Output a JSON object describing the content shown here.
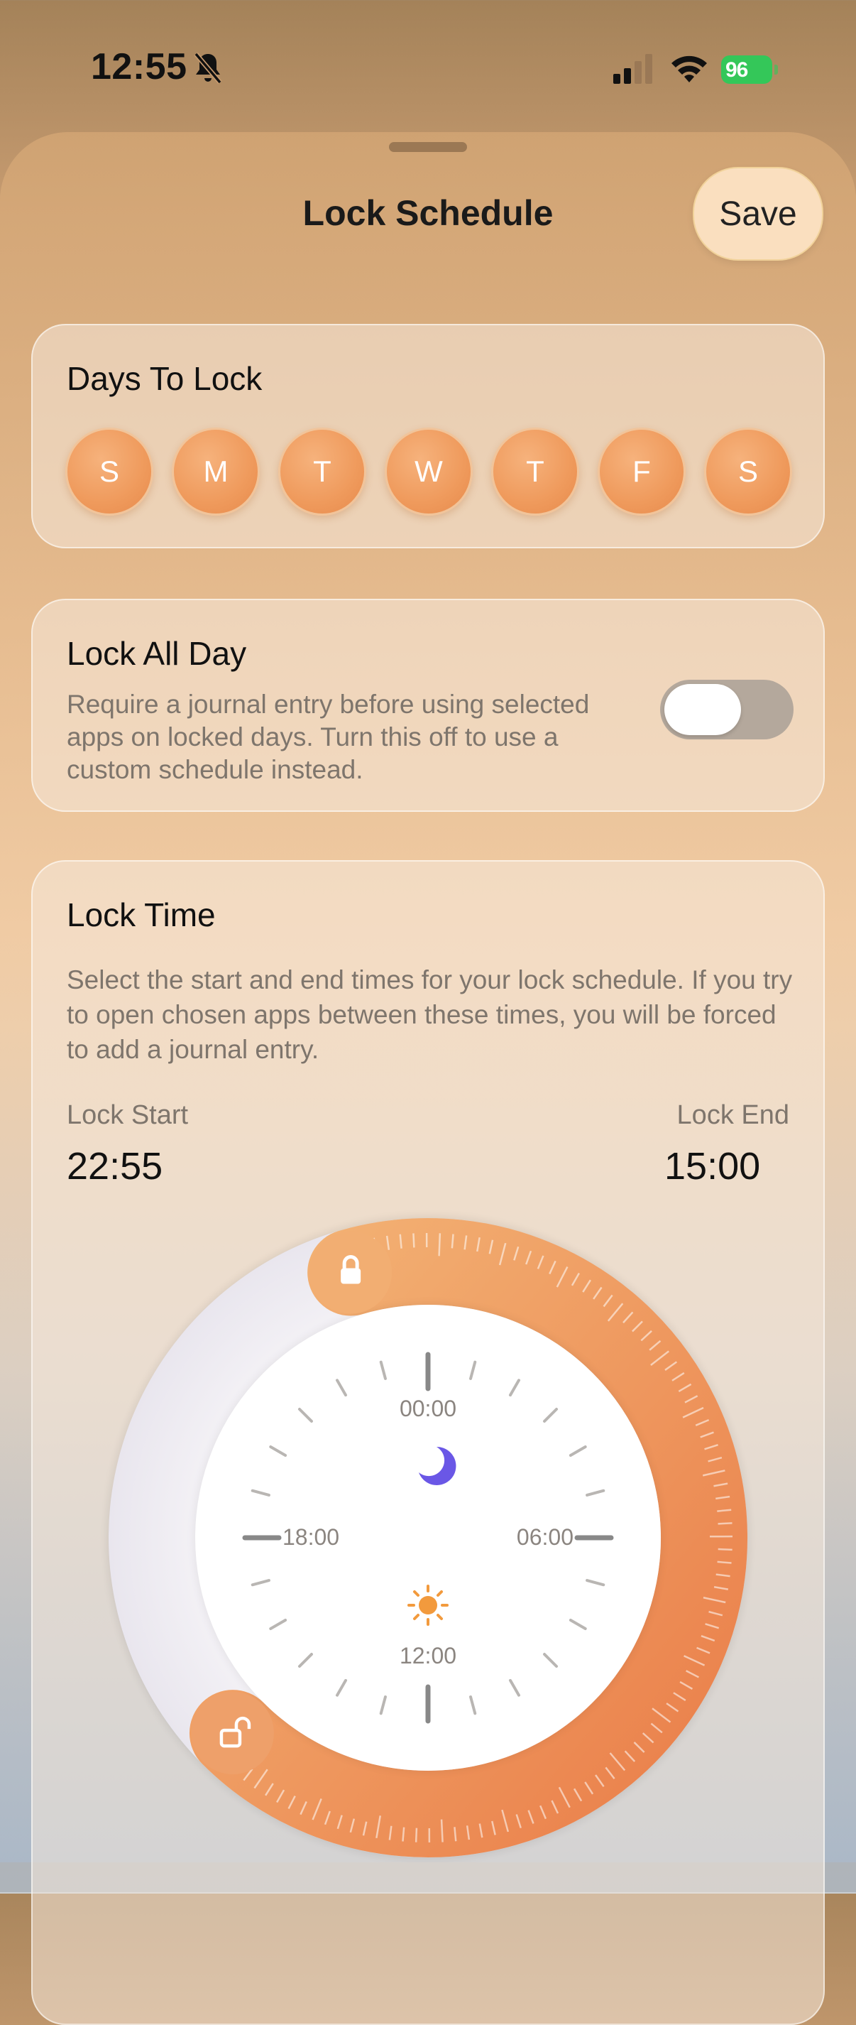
{
  "status_bar": {
    "time": "12:55",
    "battery": "96"
  },
  "sheet": {
    "title": "Lock Schedule",
    "save_label": "Save"
  },
  "days_to_lock": {
    "title": "Days To Lock",
    "days": [
      "S",
      "M",
      "T",
      "W",
      "T",
      "F",
      "S"
    ]
  },
  "lock_all_day": {
    "title": "Lock All Day",
    "description": "Require a journal entry before using selected apps on locked days. Turn this off to use a custom schedule instead.",
    "enabled": false
  },
  "lock_time": {
    "title": "Lock Time",
    "description": "Select the start and end times for your lock schedule. If you try to open chosen apps between these times, you will be forced to add a journal entry.",
    "start_label": "Lock Start",
    "start_value": "22:55",
    "end_label": "Lock End",
    "end_value": "15:00"
  },
  "clock": {
    "labels": {
      "top": "00:00",
      "right": "06:00",
      "bottom": "12:00",
      "left": "18:00"
    },
    "accent_color": "#ee8f55",
    "moon_color": "#6a57e6",
    "sun_color": "#f29a3d"
  }
}
